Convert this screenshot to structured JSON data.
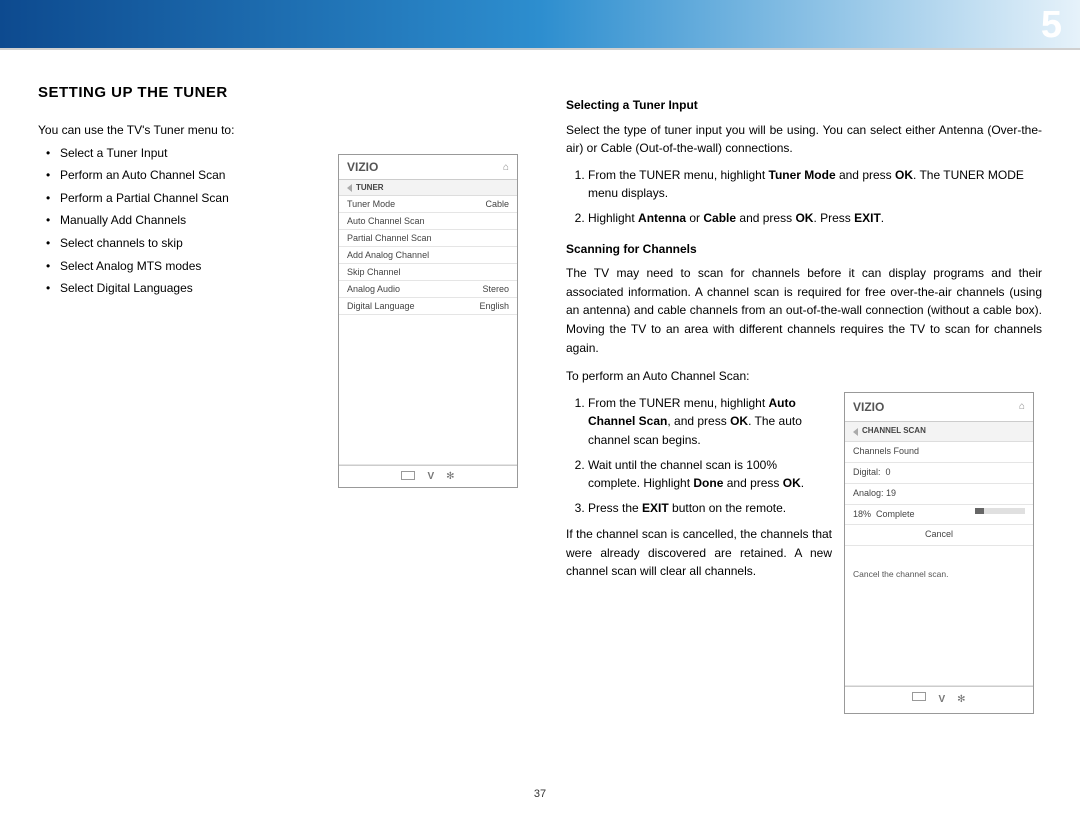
{
  "chapter_number": "5",
  "page_number": "37",
  "section_title": "SETTING UP THE TUNER",
  "intro_line": "You can use the TV's Tuner menu to:",
  "intro_bullets": [
    "Select a Tuner Input",
    "Perform an Auto Channel Scan",
    "Perform a Partial Channel Scan",
    "Manually Add Channels",
    "Select channels to skip",
    "Select Analog MTS modes",
    "Select Digital Languages"
  ],
  "tuner_osd": {
    "brand": "VIZIO",
    "crumb": "TUNER",
    "rows": [
      {
        "label": "Tuner Mode",
        "value": "Cable"
      },
      {
        "label": "Auto Channel Scan",
        "value": ""
      },
      {
        "label": "Partial Channel Scan",
        "value": ""
      },
      {
        "label": "Add Analog Channel",
        "value": ""
      },
      {
        "label": "Skip Channel",
        "value": ""
      },
      {
        "label": "Analog Audio",
        "value": "Stereo"
      },
      {
        "label": "Digital Language",
        "value": "English"
      }
    ]
  },
  "right": {
    "selecting_head": "Selecting a Tuner Input",
    "selecting_para": "Select the type of tuner input you will be using. You can select either Antenna (Over-the-air) or Cable (Out-of-the-wall) connections.",
    "selecting_step1_a": "From the TUNER menu, highlight ",
    "selecting_step1_b": "Tuner Mode",
    "selecting_step1_c": " and press ",
    "selecting_step1_d": "OK",
    "selecting_step1_e": ". The TUNER MODE menu displays.",
    "selecting_step2_a": "Highlight ",
    "selecting_step2_b": "Antenna",
    "selecting_step2_c": " or ",
    "selecting_step2_d": "Cable",
    "selecting_step2_e": " and press ",
    "selecting_step2_f": "OK",
    "selecting_step2_g": ". Press ",
    "selecting_step2_h": "EXIT",
    "selecting_step2_i": ".",
    "scanning_head": "Scanning for Channels",
    "scanning_para": "The TV may need to scan for channels before it can display programs and their associated information. A channel scan is required for free over-the-air channels (using an antenna) and cable channels from an out-of-the-wall connection (without a cable box). Moving the TV to an area with different channels requires the TV to scan for channels again.",
    "scan_intro": "To perform an Auto Channel Scan:",
    "scan_step1_a": "From the TUNER menu, highlight ",
    "scan_step1_b": "Auto Channel Scan",
    "scan_step1_c": ", and press ",
    "scan_step1_d": "OK",
    "scan_step1_e": ". The auto channel scan begins.",
    "scan_step2_a": "Wait until the channel scan is 100% complete. Highlight ",
    "scan_step2_b": "Done",
    "scan_step2_c": " and press ",
    "scan_step2_d": "OK",
    "scan_step2_e": ".",
    "scan_step3_a": "Press the ",
    "scan_step3_b": "EXIT",
    "scan_step3_c": " button on the remote.",
    "scan_note": "If the channel scan is cancelled, the channels that were already discovered are retained. A new channel scan will clear all channels."
  },
  "scan_osd": {
    "brand": "VIZIO",
    "crumb": "CHANNEL SCAN",
    "found_label": "Channels Found",
    "digital_label": "Digital:",
    "digital_value": "0",
    "analog_label": "Analog:",
    "analog_value": "19",
    "percent": "18%",
    "complete_label": "Complete",
    "cancel_label": "Cancel",
    "hint": "Cancel the channel scan."
  }
}
